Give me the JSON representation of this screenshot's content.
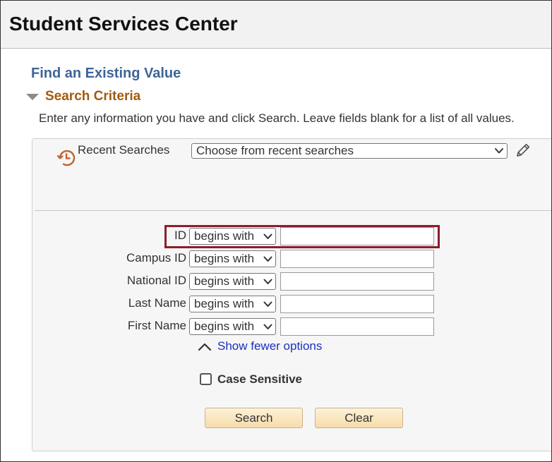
{
  "header": {
    "title": "Student Services Center"
  },
  "page": {
    "find_title": "Find an Existing Value",
    "search_criteria_label": "Search Criteria",
    "instructions": "Enter any information you have and click Search. Leave fields blank for a list of all values."
  },
  "recent": {
    "label": "Recent Searches",
    "select_value": "Choose from recent searches"
  },
  "fields": [
    {
      "label": "ID",
      "operator": "begins with",
      "value": ""
    },
    {
      "label": "Campus ID",
      "operator": "begins with",
      "value": ""
    },
    {
      "label": "National ID",
      "operator": "begins with",
      "value": ""
    },
    {
      "label": "Last Name",
      "operator": "begins with",
      "value": ""
    },
    {
      "label": "First Name",
      "operator": "begins with",
      "value": ""
    }
  ],
  "options": {
    "show_fewer_label": "Show fewer options",
    "case_sensitive_label": "Case Sensitive",
    "case_sensitive_checked": false
  },
  "buttons": {
    "search_label": "Search",
    "clear_label": "Clear"
  },
  "icons": {
    "criteria_toggle": "triangle-down-icon",
    "recent_searches": "history-clock-icon",
    "recent_dropdown": "chevron-down-icon",
    "edit_recent": "pencil-icon",
    "operator_dropdown": "chevron-down-icon",
    "show_fewer": "chevron-up-icon"
  },
  "colors": {
    "title_blue": "#3f6496",
    "criteria_brown": "#a35a0f",
    "link_blue": "#1e2fbf",
    "highlight_red": "#8c1d2c",
    "button_fill": "#f7dcaa",
    "recent_icon_orange": "#c2622e"
  }
}
